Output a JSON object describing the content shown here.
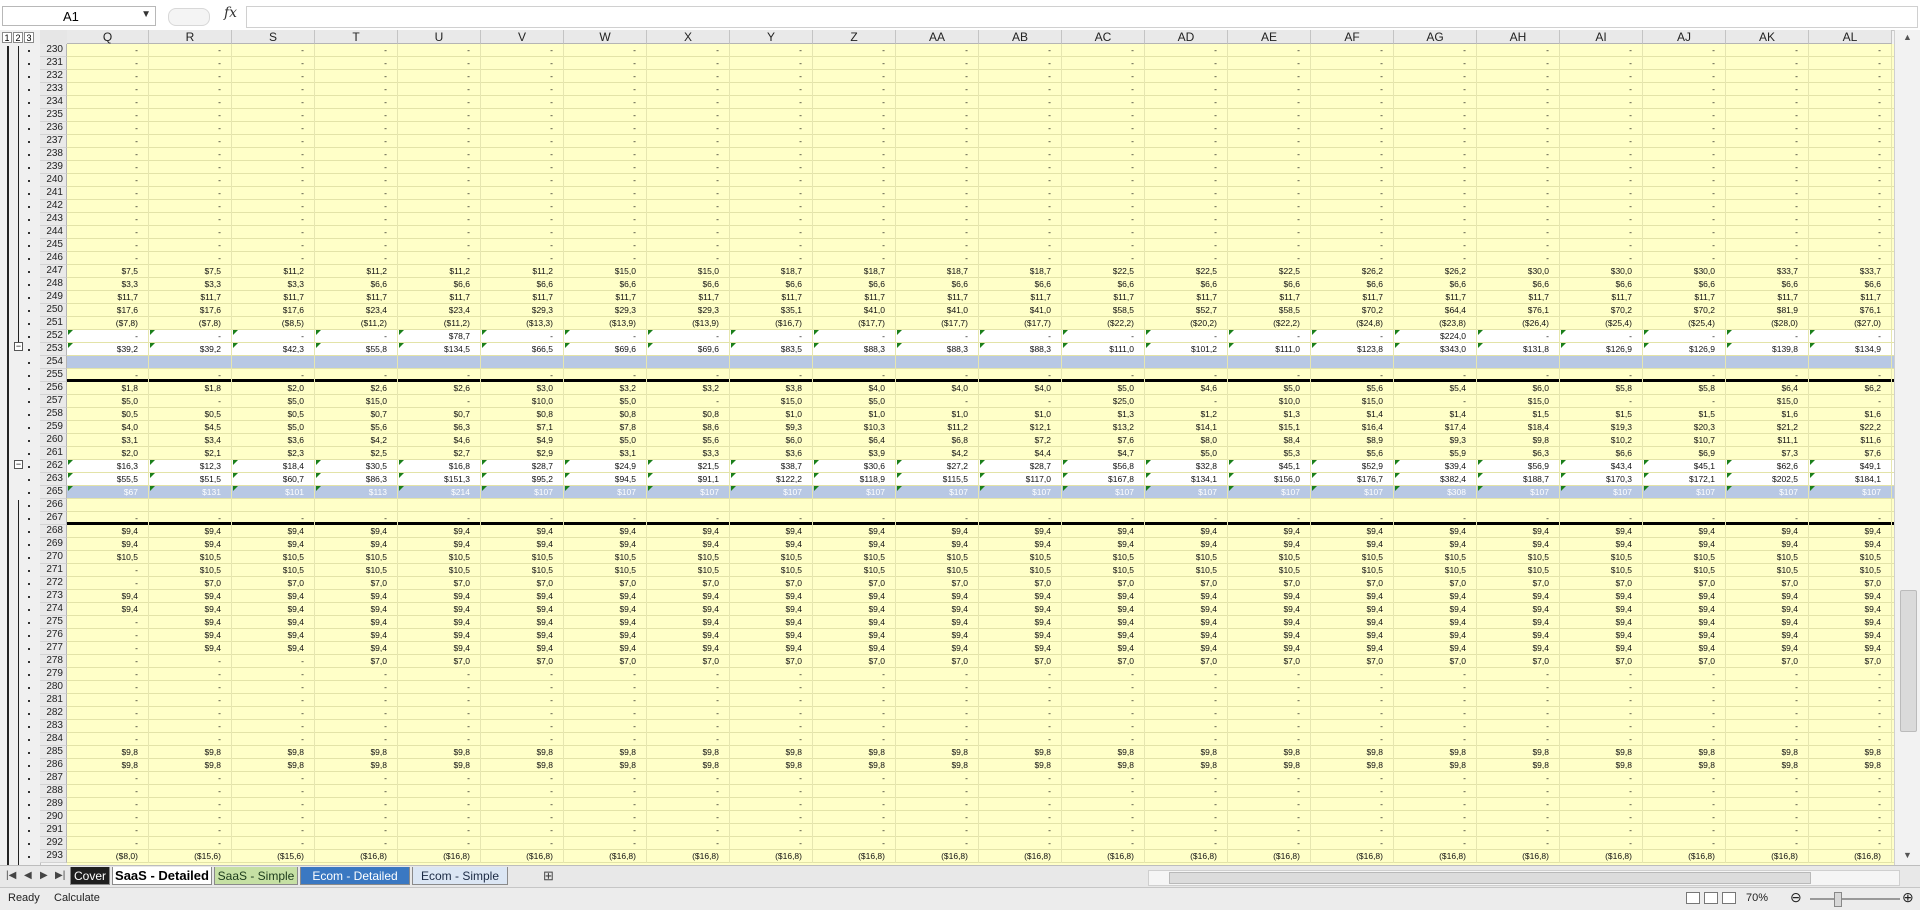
{
  "namebox": {
    "value": "A1"
  },
  "formula_bar": {
    "fx_label": "fx",
    "content": ""
  },
  "outline_levels": [
    "1",
    "2",
    "3"
  ],
  "columns": [
    "Q",
    "R",
    "S",
    "T",
    "U",
    "V",
    "W",
    "X",
    "Y",
    "Z",
    "AA",
    "AB",
    "AC",
    "AD",
    "AE",
    "AF",
    "AG",
    "AH",
    "AI",
    "AJ",
    "AK",
    "AL"
  ],
  "rows": [
    {
      "num": "230"
    },
    {
      "num": "231"
    },
    {
      "num": "232"
    },
    {
      "num": "233"
    },
    {
      "num": "234"
    },
    {
      "num": "235"
    },
    {
      "num": "236"
    },
    {
      "num": "237"
    },
    {
      "num": "238"
    },
    {
      "num": "239"
    },
    {
      "num": "240"
    },
    {
      "num": "241"
    },
    {
      "num": "242"
    },
    {
      "num": "243"
    },
    {
      "num": "244"
    },
    {
      "num": "245"
    },
    {
      "num": "246"
    },
    {
      "num": "247",
      "cells": [
        "$7,5",
        "$7,5",
        "$11,2",
        "$11,2",
        "$11,2",
        "$11,2",
        "$15,0",
        "$15,0",
        "$18,7",
        "$18,7",
        "$18,7",
        "$18,7",
        "$22,5",
        "$22,5",
        "$22,5",
        "$26,2",
        "$26,2",
        "$30,0",
        "$30,0",
        "$30,0",
        "$33,7",
        "$33,7"
      ]
    },
    {
      "num": "248",
      "cells": [
        "$3,3",
        "$3,3",
        "$3,3",
        "$6,6",
        "$6,6",
        "$6,6",
        "$6,6",
        "$6,6",
        "$6,6",
        "$6,6",
        "$6,6",
        "$6,6",
        "$6,6",
        "$6,6",
        "$6,6",
        "$6,6",
        "$6,6",
        "$6,6",
        "$6,6",
        "$6,6",
        "$6,6",
        "$6,6"
      ]
    },
    {
      "num": "249",
      "cells": [
        "$11,7",
        "$11,7",
        "$11,7",
        "$11,7",
        "$11,7",
        "$11,7",
        "$11,7",
        "$11,7",
        "$11,7",
        "$11,7",
        "$11,7",
        "$11,7",
        "$11,7",
        "$11,7",
        "$11,7",
        "$11,7",
        "$11,7",
        "$11,7",
        "$11,7",
        "$11,7",
        "$11,7",
        "$11,7"
      ]
    },
    {
      "num": "250",
      "cells": [
        "$17,6",
        "$17,6",
        "$17,6",
        "$23,4",
        "$23,4",
        "$29,3",
        "$29,3",
        "$29,3",
        "$35,1",
        "$41,0",
        "$41,0",
        "$41,0",
        "$58,5",
        "$52,7",
        "$58,5",
        "$70,2",
        "$64,4",
        "$76,1",
        "$70,2",
        "$70,2",
        "$81,9",
        "$76,1"
      ]
    },
    {
      "num": "251",
      "cells": [
        "($7,8)",
        "($7,8)",
        "($8,5)",
        "($11,2)",
        "($11,2)",
        "($13,3)",
        "($13,9)",
        "($13,9)",
        "($16,7)",
        "($17,7)",
        "($17,7)",
        "($17,7)",
        "($22,2)",
        "($20,2)",
        "($22,2)",
        "($24,8)",
        "($23,8)",
        "($26,4)",
        "($25,4)",
        "($25,4)",
        "($28,0)",
        "($27,0)"
      ]
    },
    {
      "num": "252",
      "style": "white",
      "tri": true,
      "cells": [
        "-",
        "-",
        "-",
        "-",
        "$78,7",
        "-",
        "-",
        "-",
        "-",
        "-",
        "-",
        "-",
        "-",
        "-",
        "-",
        "-",
        "$224,0",
        "-",
        "-",
        "-",
        "-",
        "-"
      ]
    },
    {
      "num": "253",
      "style": "white",
      "tri": true,
      "cells": [
        "$39,2",
        "$39,2",
        "$42,3",
        "$55,8",
        "$134,5",
        "$66,5",
        "$69,6",
        "$69,6",
        "$83,5",
        "$88,3",
        "$88,3",
        "$88,3",
        "$111,0",
        "$101,2",
        "$111,0",
        "$123,8",
        "$343,0",
        "$131,8",
        "$126,9",
        "$126,9",
        "$139,8",
        "$134,9"
      ]
    },
    {
      "num": "254",
      "style": "blue",
      "cells": [
        "",
        "",
        "",
        "",
        "",
        "",
        "",
        "",
        "",
        "",
        "",
        "",
        "",
        "",
        "",
        "",
        "",
        "",
        "",
        "",
        "",
        ""
      ]
    },
    {
      "num": "255",
      "style": "thick",
      "cells": [
        "-",
        "-",
        "-",
        "-",
        "-",
        "-",
        "-",
        "-",
        "-",
        "-",
        "-",
        "-",
        "-",
        "-",
        "-",
        "-",
        "-",
        "-",
        "-",
        "-",
        "-",
        "-"
      ]
    },
    {
      "num": "256",
      "cells": [
        "$1,8",
        "$1,8",
        "$2,0",
        "$2,6",
        "$2,6",
        "$3,0",
        "$3,2",
        "$3,2",
        "$3,8",
        "$4,0",
        "$4,0",
        "$4,0",
        "$5,0",
        "$4,6",
        "$5,0",
        "$5,6",
        "$5,4",
        "$6,0",
        "$5,8",
        "$5,8",
        "$6,4",
        "$6,2"
      ]
    },
    {
      "num": "257",
      "cells": [
        "$5,0",
        "-",
        "$5,0",
        "$15,0",
        "-",
        "$10,0",
        "$5,0",
        "-",
        "$15,0",
        "$5,0",
        "-",
        "-",
        "$25,0",
        "-",
        "$10,0",
        "$15,0",
        "-",
        "$15,0",
        "-",
        "-",
        "$15,0",
        "-"
      ]
    },
    {
      "num": "258",
      "cells": [
        "$0,5",
        "$0,5",
        "$0,5",
        "$0,7",
        "$0,7",
        "$0,8",
        "$0,8",
        "$0,8",
        "$1,0",
        "$1,0",
        "$1,0",
        "$1,0",
        "$1,3",
        "$1,2",
        "$1,3",
        "$1,4",
        "$1,4",
        "$1,5",
        "$1,5",
        "$1,5",
        "$1,6",
        "$1,6"
      ]
    },
    {
      "num": "259",
      "cells": [
        "$4,0",
        "$4,5",
        "$5,0",
        "$5,6",
        "$6,3",
        "$7,1",
        "$7,8",
        "$8,6",
        "$9,3",
        "$10,3",
        "$11,2",
        "$12,1",
        "$13,2",
        "$14,1",
        "$15,1",
        "$16,4",
        "$17,4",
        "$18,4",
        "$19,3",
        "$20,3",
        "$21,2",
        "$22,2"
      ]
    },
    {
      "num": "260",
      "cells": [
        "$3,1",
        "$3,4",
        "$3,6",
        "$4,2",
        "$4,6",
        "$4,9",
        "$5,0",
        "$5,6",
        "$6,0",
        "$6,4",
        "$6,8",
        "$7,2",
        "$7,6",
        "$8,0",
        "$8,4",
        "$8,9",
        "$9,3",
        "$9,8",
        "$10,2",
        "$10,7",
        "$11,1",
        "$11,6"
      ]
    },
    {
      "num": "261",
      "cells": [
        "$2,0",
        "$2,1",
        "$2,3",
        "$2,5",
        "$2,7",
        "$2,9",
        "$3,1",
        "$3,3",
        "$3,6",
        "$3,9",
        "$4,2",
        "$4,4",
        "$4,7",
        "$5,0",
        "$5,3",
        "$5,6",
        "$5,9",
        "$6,3",
        "$6,6",
        "$6,9",
        "$7,3",
        "$7,6"
      ]
    },
    {
      "num": "262",
      "style": "white",
      "tri": true,
      "cells": [
        "$16,3",
        "$12,3",
        "$18,4",
        "$30,5",
        "$16,8",
        "$28,7",
        "$24,9",
        "$21,5",
        "$38,7",
        "$30,6",
        "$27,2",
        "$28,7",
        "$56,8",
        "$32,8",
        "$45,1",
        "$52,9",
        "$39,4",
        "$56,9",
        "$43,4",
        "$45,1",
        "$62,6",
        "$49,1"
      ]
    },
    {
      "num": "263",
      "style": "white",
      "tri": true,
      "cells": [
        "$55,5",
        "$51,5",
        "$60,7",
        "$86,3",
        "$151,3",
        "$95,2",
        "$94,5",
        "$91,1",
        "$122,2",
        "$118,9",
        "$115,5",
        "$117,0",
        "$167,8",
        "$134,1",
        "$156,0",
        "$176,7",
        "$382,4",
        "$188,7",
        "$170,3",
        "$172,1",
        "$202,5",
        "$184,1"
      ]
    },
    {
      "num": "265",
      "style": "blue",
      "tri": true,
      "cells": [
        "$67",
        "$131",
        "$101",
        "$113",
        "$214",
        "$107",
        "$107",
        "$107",
        "$107",
        "$107",
        "$107",
        "$107",
        "$107",
        "$107",
        "$107",
        "$107",
        "$308",
        "$107",
        "$107",
        "$107",
        "$107",
        "$107"
      ]
    },
    {
      "num": "266",
      "cells": [
        "",
        "",
        "",
        "",
        "",
        "",
        "",
        "",
        "",
        "",
        "",
        "",
        "",
        "",
        "",
        "",
        "",
        "",
        "",
        "",
        "",
        ""
      ]
    },
    {
      "num": "267",
      "style": "thick",
      "cells": [
        "-",
        "-",
        "-",
        "-",
        "-",
        "-",
        "-",
        "-",
        "-",
        "-",
        "-",
        "-",
        "-",
        "-",
        "-",
        "-",
        "-",
        "-",
        "-",
        "-",
        "-",
        "-"
      ]
    },
    {
      "num": "268",
      "cells": [
        "$9,4",
        "$9,4",
        "$9,4",
        "$9,4",
        "$9,4",
        "$9,4",
        "$9,4",
        "$9,4",
        "$9,4",
        "$9,4",
        "$9,4",
        "$9,4",
        "$9,4",
        "$9,4",
        "$9,4",
        "$9,4",
        "$9,4",
        "$9,4",
        "$9,4",
        "$9,4",
        "$9,4",
        "$9,4"
      ]
    },
    {
      "num": "269",
      "cells": [
        "$9,4",
        "$9,4",
        "$9,4",
        "$9,4",
        "$9,4",
        "$9,4",
        "$9,4",
        "$9,4",
        "$9,4",
        "$9,4",
        "$9,4",
        "$9,4",
        "$9,4",
        "$9,4",
        "$9,4",
        "$9,4",
        "$9,4",
        "$9,4",
        "$9,4",
        "$9,4",
        "$9,4",
        "$9,4"
      ]
    },
    {
      "num": "270",
      "cells": [
        "$10,5",
        "$10,5",
        "$10,5",
        "$10,5",
        "$10,5",
        "$10,5",
        "$10,5",
        "$10,5",
        "$10,5",
        "$10,5",
        "$10,5",
        "$10,5",
        "$10,5",
        "$10,5",
        "$10,5",
        "$10,5",
        "$10,5",
        "$10,5",
        "$10,5",
        "$10,5",
        "$10,5",
        "$10,5"
      ]
    },
    {
      "num": "271",
      "cells": [
        "-",
        "$10,5",
        "$10,5",
        "$10,5",
        "$10,5",
        "$10,5",
        "$10,5",
        "$10,5",
        "$10,5",
        "$10,5",
        "$10,5",
        "$10,5",
        "$10,5",
        "$10,5",
        "$10,5",
        "$10,5",
        "$10,5",
        "$10,5",
        "$10,5",
        "$10,5",
        "$10,5",
        "$10,5"
      ]
    },
    {
      "num": "272",
      "cells": [
        "-",
        "$7,0",
        "$7,0",
        "$7,0",
        "$7,0",
        "$7,0",
        "$7,0",
        "$7,0",
        "$7,0",
        "$7,0",
        "$7,0",
        "$7,0",
        "$7,0",
        "$7,0",
        "$7,0",
        "$7,0",
        "$7,0",
        "$7,0",
        "$7,0",
        "$7,0",
        "$7,0",
        "$7,0"
      ]
    },
    {
      "num": "273",
      "cells": [
        "$9,4",
        "$9,4",
        "$9,4",
        "$9,4",
        "$9,4",
        "$9,4",
        "$9,4",
        "$9,4",
        "$9,4",
        "$9,4",
        "$9,4",
        "$9,4",
        "$9,4",
        "$9,4",
        "$9,4",
        "$9,4",
        "$9,4",
        "$9,4",
        "$9,4",
        "$9,4",
        "$9,4",
        "$9,4"
      ]
    },
    {
      "num": "274",
      "cells": [
        "$9,4",
        "$9,4",
        "$9,4",
        "$9,4",
        "$9,4",
        "$9,4",
        "$9,4",
        "$9,4",
        "$9,4",
        "$9,4",
        "$9,4",
        "$9,4",
        "$9,4",
        "$9,4",
        "$9,4",
        "$9,4",
        "$9,4",
        "$9,4",
        "$9,4",
        "$9,4",
        "$9,4",
        "$9,4"
      ]
    },
    {
      "num": "275",
      "cells": [
        "-",
        "$9,4",
        "$9,4",
        "$9,4",
        "$9,4",
        "$9,4",
        "$9,4",
        "$9,4",
        "$9,4",
        "$9,4",
        "$9,4",
        "$9,4",
        "$9,4",
        "$9,4",
        "$9,4",
        "$9,4",
        "$9,4",
        "$9,4",
        "$9,4",
        "$9,4",
        "$9,4",
        "$9,4"
      ]
    },
    {
      "num": "276",
      "cells": [
        "-",
        "$9,4",
        "$9,4",
        "$9,4",
        "$9,4",
        "$9,4",
        "$9,4",
        "$9,4",
        "$9,4",
        "$9,4",
        "$9,4",
        "$9,4",
        "$9,4",
        "$9,4",
        "$9,4",
        "$9,4",
        "$9,4",
        "$9,4",
        "$9,4",
        "$9,4",
        "$9,4",
        "$9,4"
      ]
    },
    {
      "num": "277",
      "cells": [
        "-",
        "$9,4",
        "$9,4",
        "$9,4",
        "$9,4",
        "$9,4",
        "$9,4",
        "$9,4",
        "$9,4",
        "$9,4",
        "$9,4",
        "$9,4",
        "$9,4",
        "$9,4",
        "$9,4",
        "$9,4",
        "$9,4",
        "$9,4",
        "$9,4",
        "$9,4",
        "$9,4",
        "$9,4"
      ]
    },
    {
      "num": "278",
      "cells": [
        "-",
        "-",
        "-",
        "$7,0",
        "$7,0",
        "$7,0",
        "$7,0",
        "$7,0",
        "$7,0",
        "$7,0",
        "$7,0",
        "$7,0",
        "$7,0",
        "$7,0",
        "$7,0",
        "$7,0",
        "$7,0",
        "$7,0",
        "$7,0",
        "$7,0",
        "$7,0",
        "$7,0"
      ]
    },
    {
      "num": "279"
    },
    {
      "num": "280"
    },
    {
      "num": "281"
    },
    {
      "num": "282"
    },
    {
      "num": "283"
    },
    {
      "num": "284"
    },
    {
      "num": "285",
      "cells": [
        "$9,8",
        "$9,8",
        "$9,8",
        "$9,8",
        "$9,8",
        "$9,8",
        "$9,8",
        "$9,8",
        "$9,8",
        "$9,8",
        "$9,8",
        "$9,8",
        "$9,8",
        "$9,8",
        "$9,8",
        "$9,8",
        "$9,8",
        "$9,8",
        "$9,8",
        "$9,8",
        "$9,8",
        "$9,8"
      ]
    },
    {
      "num": "286",
      "cells": [
        "$9,8",
        "$9,8",
        "$9,8",
        "$9,8",
        "$9,8",
        "$9,8",
        "$9,8",
        "$9,8",
        "$9,8",
        "$9,8",
        "$9,8",
        "$9,8",
        "$9,8",
        "$9,8",
        "$9,8",
        "$9,8",
        "$9,8",
        "$9,8",
        "$9,8",
        "$9,8",
        "$9,8",
        "$9,8"
      ]
    },
    {
      "num": "287"
    },
    {
      "num": "288"
    },
    {
      "num": "289"
    },
    {
      "num": "290"
    },
    {
      "num": "291"
    },
    {
      "num": "292"
    },
    {
      "num": "293",
      "cells": [
        "($8,0)",
        "($15,6)",
        "($15,6)",
        "($16,8)",
        "($16,8)",
        "($16,8)",
        "($16,8)",
        "($16,8)",
        "($16,8)",
        "($16,8)",
        "($16,8)",
        "($16,8)",
        "($16,8)",
        "($16,8)",
        "($16,8)",
        "($16,8)",
        "($16,8)",
        "($16,8)",
        "($16,8)",
        "($16,8)",
        "($16,8)",
        "($16,8)"
      ]
    }
  ],
  "sheet_tabs": [
    {
      "label": "Cover",
      "bg": "#1f1f1f",
      "fg": "#ffffff",
      "active": false
    },
    {
      "label": "SaaS - Detailed",
      "bg": "#ffffff",
      "fg": "#000000",
      "active": true
    },
    {
      "label": "SaaS - Simple",
      "bg": "#c6e0a4",
      "fg": "#1b3a1b",
      "active": false
    },
    {
      "label": "Ecom - Detailed",
      "bg": "#3a78c2",
      "fg": "#ffffff",
      "active": false
    },
    {
      "label": "Ecom - Simple",
      "bg": "#dbe6f4",
      "fg": "#1b2a44",
      "active": false
    }
  ],
  "status_bar": {
    "ready": "Ready",
    "calculate": "Calculate",
    "zoom": "70%"
  },
  "colors": {
    "cell_fill": "#ffffc8",
    "band_blue": "#b8c8e4",
    "error_triangle": "#1a7f1a"
  },
  "icons": [
    "fx-icon",
    "insert-sheet-icon",
    "normal-view-icon",
    "page-layout-icon",
    "page-break-icon",
    "zoom-out-icon",
    "zoom-in-icon"
  ]
}
